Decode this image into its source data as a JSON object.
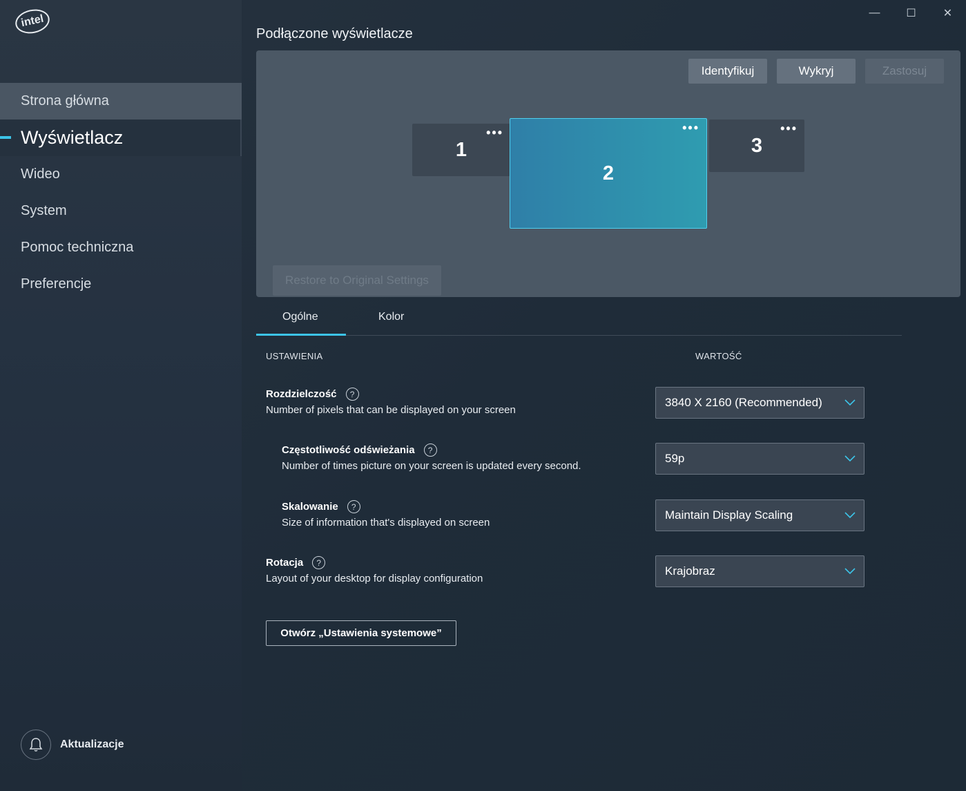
{
  "brand": {
    "logo_text": "intel"
  },
  "window": {
    "minimize": "—",
    "maximize": "☐",
    "close": "✕"
  },
  "sidebar": {
    "items": [
      {
        "label": "Strona główna"
      },
      {
        "label": "Wyświetlacz"
      },
      {
        "label": "Wideo"
      },
      {
        "label": "System"
      },
      {
        "label": "Pomoc techniczna"
      },
      {
        "label": "Preferencje"
      }
    ],
    "updates_label": "Aktualizacje"
  },
  "main": {
    "title": "Podłączone wyświetlacze",
    "buttons": {
      "identify": "Identyfikuj",
      "detect": "Wykryj",
      "apply": "Zastosuj"
    },
    "monitors": [
      {
        "number": "1",
        "menu": "•••"
      },
      {
        "number": "2",
        "menu": "•••"
      },
      {
        "number": "3",
        "menu": "•••"
      }
    ],
    "restore": "Restore to Original Settings",
    "tabs": [
      {
        "label": "Ogólne"
      },
      {
        "label": "Kolor"
      }
    ],
    "columns": {
      "settings": "USTAWIENIA",
      "value": "WARTOŚĆ"
    },
    "settings": [
      {
        "title": "Rozdzielczość",
        "desc": "Number of pixels that can be displayed on your screen",
        "value": "3840 X 2160 (Recommended)"
      },
      {
        "title": "Częstotliwość odświeżania",
        "desc": "Number of times picture on your screen is updated every second.",
        "value": "59p"
      },
      {
        "title": "Skalowanie",
        "desc": "Size of information that's displayed on screen",
        "value": "Maintain Display Scaling"
      },
      {
        "title": "Rotacja",
        "desc": "Layout of your desktop for display configuration",
        "value": "Krajobraz"
      }
    ],
    "help_glyph": "?",
    "open_system_settings": "Otwórz „Ustawienia systemowe”"
  },
  "colors": {
    "accent": "#3cc4e8",
    "selected_monitor": "#2f8fad"
  }
}
